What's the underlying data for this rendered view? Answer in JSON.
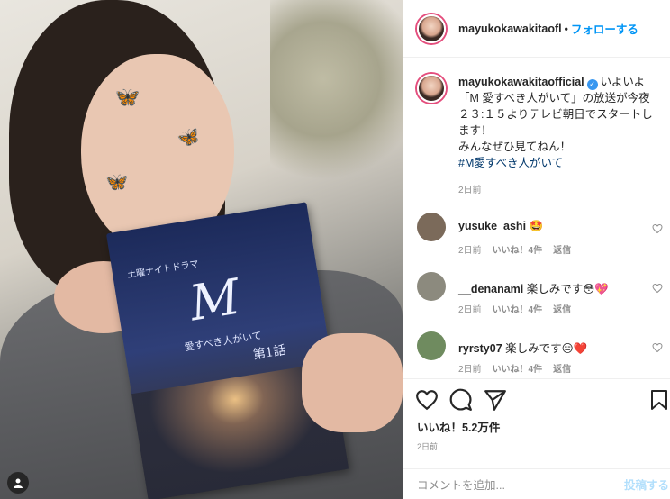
{
  "post": {
    "username": "mayukokawakitaofl",
    "follow_label": "フォローする",
    "separator": "•"
  },
  "caption": {
    "username": "mayukokawakitaofficial",
    "line1": "いよいよ「M 愛すべき人がいて」の放送が今夜２３:１５よりテレビ朝日でスタートします！",
    "line2": "みんなぜひ見てねん！",
    "hashtag": "#M愛すべき人がいて",
    "time": "2日前"
  },
  "photo": {
    "book_series": "土曜ナイトドラマ",
    "book_letter": "M",
    "book_title": "愛すべき人がいて",
    "book_episode": "第1話"
  },
  "comments": [
    {
      "user": "yusuke_ashi",
      "text": "🤩",
      "time": "2日前",
      "likes": "",
      "reply": "返信",
      "avatar_color": "#7b6a5a"
    },
    {
      "user": "__denanami",
      "text": "楽しみです😳💖",
      "time": "2日前",
      "likes": "いいね！4件",
      "reply": "返信",
      "avatar_color": "#8c8a7e"
    },
    {
      "user": "ryrsty07",
      "text": "楽しみです😑❤️",
      "time": "2日前",
      "likes": "いいね！4件",
      "reply": "返信",
      "avatar_color": "#6f8b5f"
    }
  ],
  "first_comment_likes": "いいね！4件",
  "likes_count": "いいね！5.2万件",
  "post_time": "2日前",
  "add_comment": {
    "placeholder": "コメントを追加...",
    "post_label": "投稿する"
  },
  "colors": {
    "link": "#0095f6",
    "hashtag": "#00376b",
    "verified": "#3897f0",
    "heart": "#ed4956"
  }
}
